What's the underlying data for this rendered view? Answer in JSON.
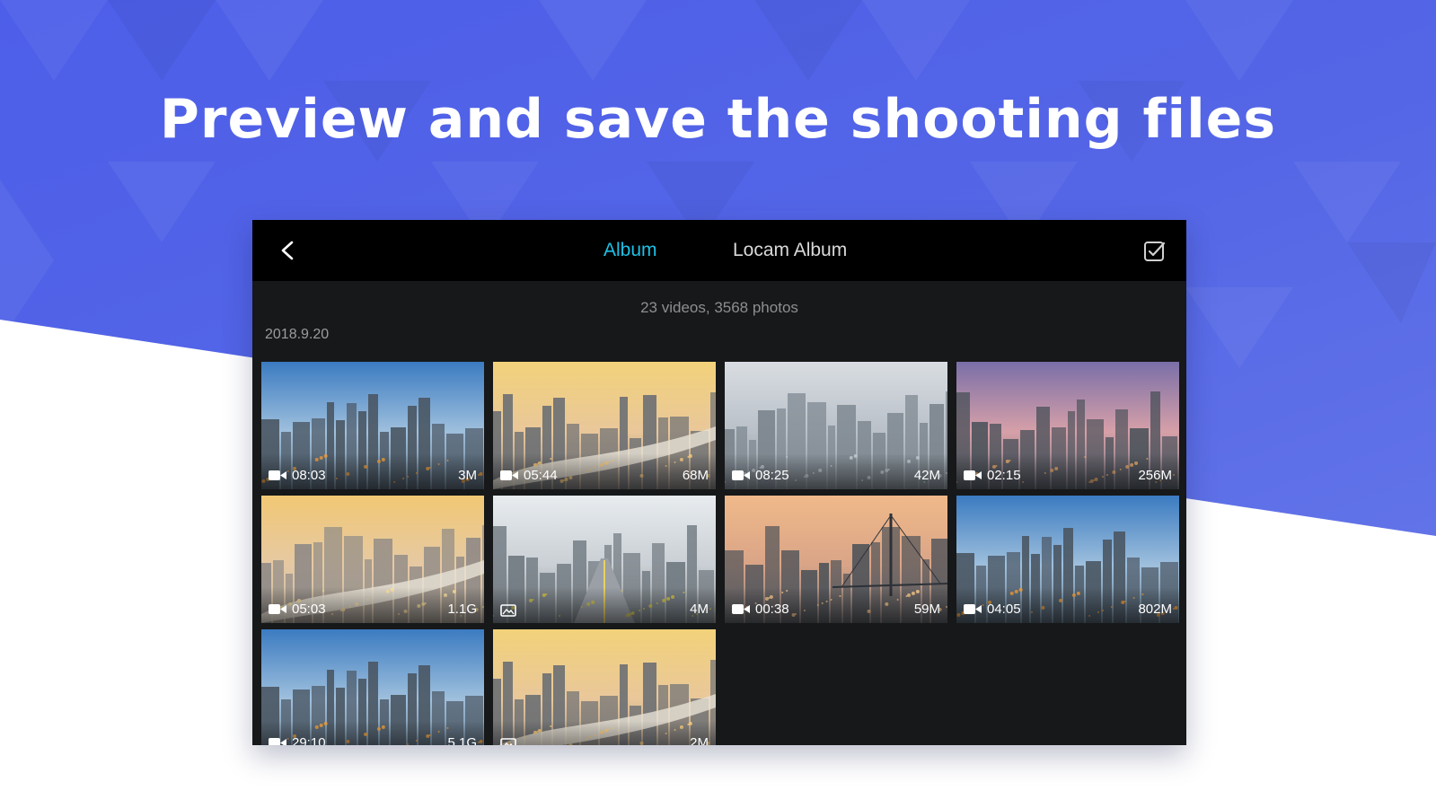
{
  "headline": "Preview and save the shooting files",
  "colors": {
    "brand_blue": "#4d5ee9",
    "tab_active": "#1ec0e6",
    "tab_inactive": "#d9d9d9",
    "panel_bg": "#161819",
    "topbar_bg": "#000000"
  },
  "app": {
    "back_icon": "back-arrow-icon",
    "tabs": [
      {
        "label": "Album",
        "active": true
      },
      {
        "label": "Locam Album",
        "active": false
      }
    ],
    "select_icon": "checkbox-select-icon",
    "summary": "23 videos, 3568 photos",
    "date_group": "2018.9.20",
    "items": [
      {
        "kind": "video",
        "time": "08:03",
        "size": "3M",
        "scene": "sky"
      },
      {
        "kind": "video",
        "time": "05:44",
        "size": "68M",
        "scene": "sunset-tower"
      },
      {
        "kind": "video",
        "time": "08:25",
        "size": "42M",
        "scene": "foggy"
      },
      {
        "kind": "video",
        "time": "02:15",
        "size": "256M",
        "scene": "dusk"
      },
      {
        "kind": "video",
        "time": "05:03",
        "size": "1.1G",
        "scene": "river"
      },
      {
        "kind": "photo",
        "time": "",
        "size": "4M",
        "scene": "road"
      },
      {
        "kind": "video",
        "time": "00:38",
        "size": "59M",
        "scene": "bridge"
      },
      {
        "kind": "video",
        "time": "04:05",
        "size": "802M",
        "scene": "sky"
      },
      {
        "kind": "video",
        "time": "29:10",
        "size": "5.1G",
        "scene": "sky"
      },
      {
        "kind": "photo",
        "time": "",
        "size": "2M",
        "scene": "sunset-tower"
      }
    ]
  }
}
